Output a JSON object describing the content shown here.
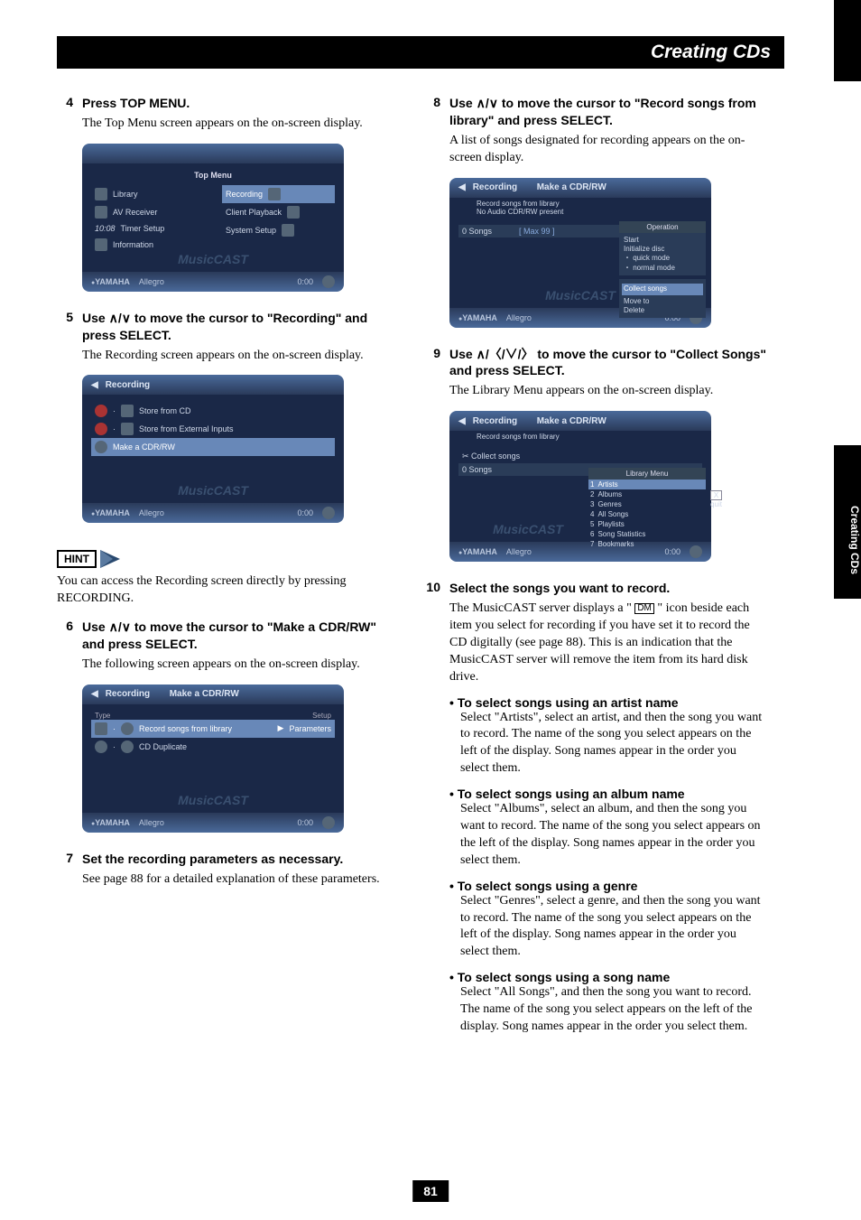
{
  "header": {
    "title": "Creating CDs"
  },
  "side_tab": "Creating CDs",
  "page_number": "81",
  "left": {
    "s4": {
      "num": "4",
      "title": "Press TOP MENU.",
      "body": "The Top Menu screen appears on the on-screen display."
    },
    "shot4": {
      "title": "Top Menu",
      "left_items": [
        "Library",
        "AV Receiver",
        "Timer Setup",
        "Information"
      ],
      "right_items": [
        "Recording",
        "Client Playback",
        "System Setup"
      ],
      "foot_brand": "YAMAHA",
      "foot_track": "Allegro",
      "foot_time": "0:00",
      "watermark": "MusicCAST",
      "timer": "10:08"
    },
    "s5": {
      "num": "5",
      "title_a": "Use ",
      "title_b": " to move the cursor to \"Recording\" and press SELECT.",
      "arrows": "／",
      "body": "The Recording screen appears on the on-screen display."
    },
    "shot5": {
      "title": "Recording",
      "items": [
        "Store from CD",
        "Store from External Inputs",
        "Make a CDR/RW"
      ],
      "foot_brand": "YAMAHA",
      "foot_track": "Allegro",
      "foot_time": "0:00",
      "watermark": "MusicCAST"
    },
    "hint_label": "HINT",
    "hint_body": "You can access the Recording screen directly by pressing RECORDING.",
    "s6": {
      "num": "6",
      "title_a": "Use ",
      "title_b": " to move the cursor to \"Make a CDR/RW\" and press SELECT.",
      "body": "The following screen appears on the on-screen display."
    },
    "shot6": {
      "title_a": "Recording",
      "title_b": "Make a CDR/RW",
      "col_type": "Type",
      "col_setup": "Setup",
      "row1": "Record songs from library",
      "row1b": "Parameters",
      "row2": "CD Duplicate",
      "foot_brand": "YAMAHA",
      "foot_track": "Allegro",
      "foot_time": "0:00",
      "watermark": "MusicCAST"
    },
    "s7": {
      "num": "7",
      "title": "Set the recording parameters as necessary.",
      "body": "See page 88 for a detailed explanation of these parameters."
    }
  },
  "right": {
    "s8": {
      "num": "8",
      "title_a": "Use ",
      "title_b": " to move the cursor to \"Record songs from library\" and press SELECT.",
      "body": "A list of songs designated for recording appears on the on-screen display."
    },
    "shot8": {
      "title_a": "Recording",
      "title_b": "Make a CDR/RW",
      "sub": "Record songs from library",
      "sub2": "No Audio CDR/RW present",
      "songs_h": "0  Songs",
      "max": "[ Max 99 ]",
      "op_title": "Operation",
      "ops": [
        "Start",
        "Initialize disc",
        "・ quick mode",
        "・ normal mode"
      ],
      "ops2": [
        "Collect songs",
        "Move to",
        "Delete"
      ],
      "foot_brand": "YAMAHA",
      "foot_track": "Allegro",
      "foot_time": "0:00",
      "watermark": "MusicCAST"
    },
    "s9": {
      "num": "9",
      "title_a": "Use ",
      "title_b": " to move the cursor to \"Collect Songs\" and press SELECT.",
      "arrows": "／〈／／〉",
      "body": "The Library Menu appears on the on-screen display."
    },
    "shot9": {
      "title_a": "Recording",
      "title_b": "Make a CDR/RW",
      "sub": "Record songs from library",
      "collect": "Collect songs",
      "songs_h": "0  Songs",
      "lib_title": "Library Menu",
      "lib": [
        "Artists",
        "Albums",
        "Genres",
        "All Songs",
        "Playlists",
        "Song Statistics",
        "Bookmarks"
      ],
      "quit_x": "X",
      "quit": "quit",
      "foot_brand": "YAMAHA",
      "foot_track": "Allegro",
      "foot_time": "0:00",
      "watermark": "MusicCAST"
    },
    "s10": {
      "num": "10",
      "title": "Select the songs you want to record.",
      "body_a": "The MusicCAST server displays a \" ",
      "dm": "DM",
      "body_b": " \" icon beside each item you select for recording if you have set it to record the CD digitally (see page 88). This is an indication that the MusicCAST server will remove the item from its hard disk drive.",
      "b1_t": "• To select songs using an artist name",
      "b1": "Select \"Artists\", select an artist, and then the song you want to record. The name of the song you select appears on the left of the display. Song names appear in the order you select them.",
      "b2_t": "• To select songs using an album name",
      "b2": "Select \"Albums\", select an album, and then the song you want to record. The name of the song you select appears on the left of the display. Song names appear in the order you select them.",
      "b3_t": "• To select songs using a genre",
      "b3": "Select \"Genres\", select a genre, and then the song you want to record. The name of the song you select appears on the left of the display. Song names appear in the order you select them.",
      "b4_t": "• To select songs using a song name",
      "b4": "Select \"All Songs\", and then the song you want to record. The name of the song you select appears on the left of the display. Song names appear in the order you select them."
    }
  }
}
